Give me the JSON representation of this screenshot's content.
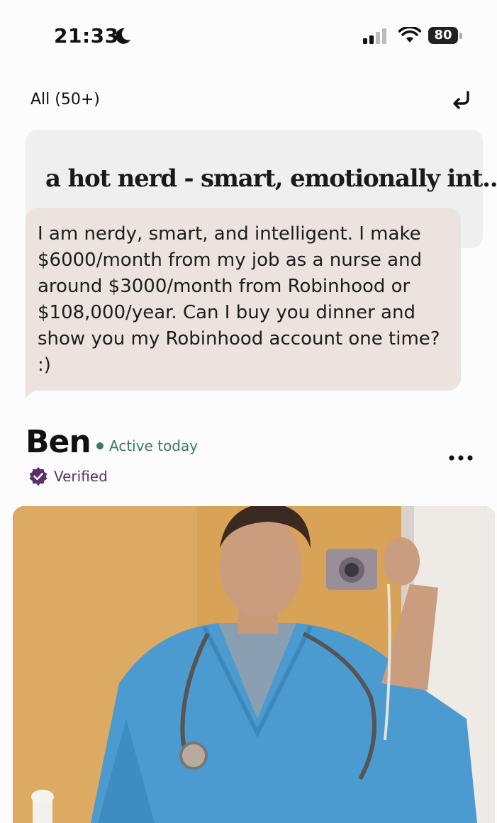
{
  "status_bar": {
    "time": "21:33",
    "battery": "80"
  },
  "header": {
    "filter_label": "All (50+)"
  },
  "prompt": {
    "title": "a hot nerd - smart, emotionally int..."
  },
  "comment": {
    "text": "I am nerdy, smart, and intelligent. I make $6000/month from my job as a nurse and around $3000/month from Robinhood or $108,000/year. Can I buy you dinner and show you my Robinhood account one time? :)"
  },
  "profile": {
    "name": "Ben",
    "activity": "Active today",
    "verified_label": "Verified"
  },
  "colors": {
    "active_green": "#3a7a5c",
    "verified_purple": "#5b2f6b",
    "comment_bg": "#ece2df",
    "prompt_bg": "#efefef"
  },
  "icons": [
    "moon-icon",
    "signal-icon",
    "wifi-icon",
    "battery-icon",
    "undo-icon",
    "more-icon",
    "verified-badge-icon"
  ]
}
